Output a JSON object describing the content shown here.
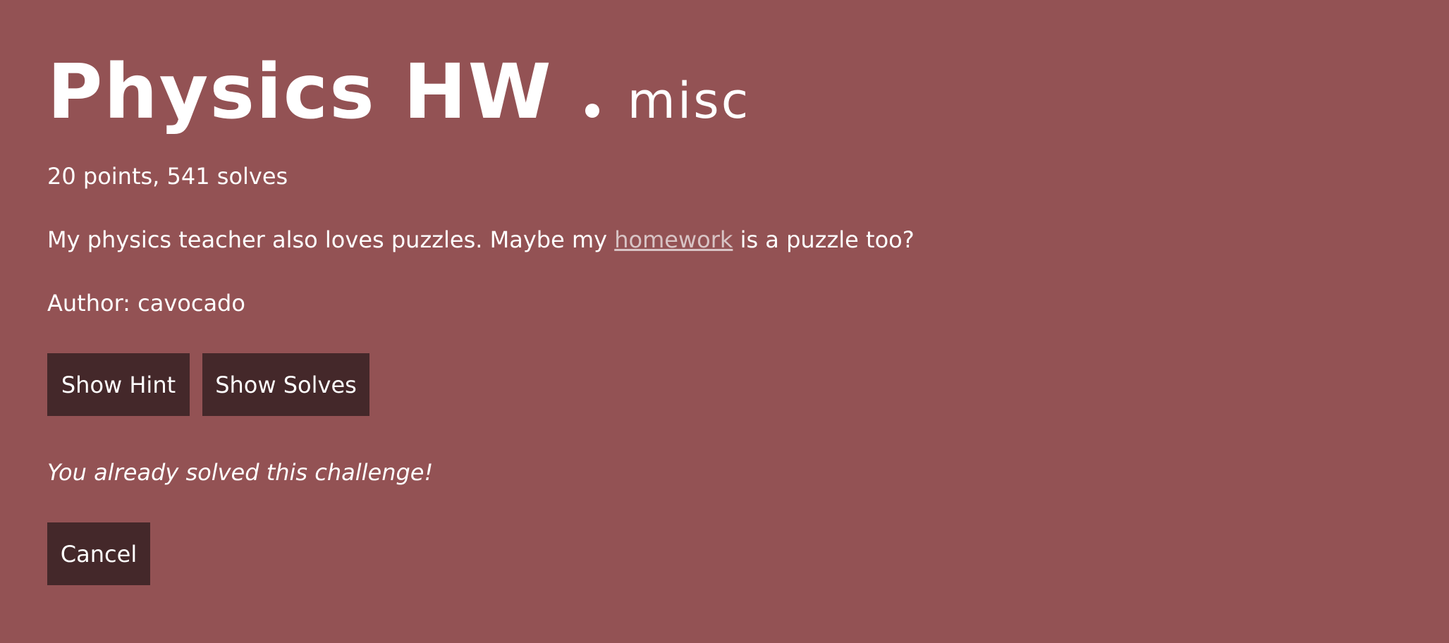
{
  "challenge": {
    "title": "Physics HW",
    "category": "misc",
    "meta": "20 points, 541 solves",
    "description_before": "My physics teacher also loves puzzles. Maybe my ",
    "description_link": "homework",
    "description_after": " is a puzzle too?",
    "author": "Author: cavocado",
    "solved_message": "You already solved this challenge!"
  },
  "buttons": {
    "hint": "Show Hint",
    "solves": "Show Solves",
    "cancel": "Cancel"
  },
  "colors": {
    "background": "#935254",
    "button": "#44282a",
    "link": "#d8c4c5",
    "text": "#ffffff"
  }
}
